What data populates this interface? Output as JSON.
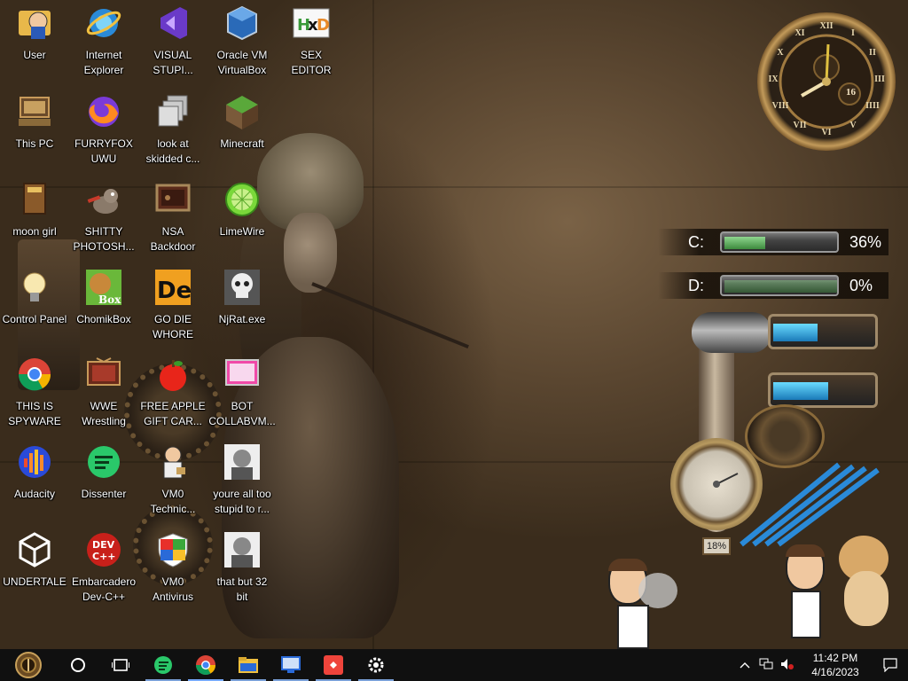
{
  "desktop": {
    "icons": [
      {
        "label": "User",
        "icon": "user-folder-icon"
      },
      {
        "label": "Internet\nExplorer",
        "icon": "internet-explorer-icon"
      },
      {
        "label": "VISUAL\nSTUPI...",
        "icon": "visual-studio-icon"
      },
      {
        "label": "Oracle VM\nVirtualBox",
        "icon": "virtualbox-icon"
      },
      {
        "label": "SEX\nEDITOR",
        "icon": "hex-editor-icon"
      },
      {
        "label": "This PC",
        "icon": "computer-icon"
      },
      {
        "label": "FURRYFOX\nUWU",
        "icon": "firefox-icon"
      },
      {
        "label": "look at\nskidded c...",
        "icon": "shortcut-stack-icon"
      },
      {
        "label": "Minecraft",
        "icon": "minecraft-icon"
      },
      {
        "label": "moon girl",
        "icon": "book-icon"
      },
      {
        "label": "SHITTY\nPHOTOSH...",
        "icon": "gimp-icon"
      },
      {
        "label": "NSA\nBackdoor",
        "icon": "monitor-icon"
      },
      {
        "label": "LimeWire",
        "icon": "limewire-icon"
      },
      {
        "label": "Control Panel",
        "icon": "lightbulb-icon"
      },
      {
        "label": "ChomikBox",
        "icon": "chomikbox-icon"
      },
      {
        "label": "GO DIE\nWHORE",
        "icon": "de-icon"
      },
      {
        "label": "NjRat.exe",
        "icon": "skull-icon"
      },
      {
        "label": "THIS IS\nSPYWARE",
        "icon": "chrome-icon"
      },
      {
        "label": "WWE\nWrestling",
        "icon": "tv-icon"
      },
      {
        "label": "FREE APPLE\nGIFT CAR...",
        "icon": "apple-icon"
      },
      {
        "label": "BOT\nCOLLABVM...",
        "icon": "screen-icon"
      },
      {
        "label": "Audacity",
        "icon": "audacity-icon"
      },
      {
        "label": "Dissenter",
        "icon": "dissenter-icon"
      },
      {
        "label": "VM0\nTechnic...",
        "icon": "technician-icon"
      },
      {
        "label": "youre all too\nstupid to r...",
        "icon": "portrait-icon"
      },
      {
        "label": "UNDERTALE",
        "icon": "unity-icon"
      },
      {
        "label": "Embarcadero\nDev-C++",
        "icon": "devcpp-icon"
      },
      {
        "label": "VM0\nAntivirus",
        "icon": "shield-icon"
      },
      {
        "label": "that but 32\nbit",
        "icon": "portrait-icon"
      }
    ]
  },
  "gadgets": {
    "clock": {
      "numerals": [
        "XII",
        "I",
        "II",
        "III",
        "IIII",
        "V",
        "VI",
        "VII",
        "VIII",
        "IX",
        "X",
        "XI"
      ],
      "date_badge": "16"
    },
    "drives": [
      {
        "letter": "C:",
        "percent": 36,
        "label": "36%"
      },
      {
        "letter": "D:",
        "percent": 0,
        "label": "0%"
      }
    ],
    "cpu_tubes": [
      {
        "fraction": 0.45
      },
      {
        "fraction": 0.55
      }
    ],
    "gauge": {
      "label": "18%"
    }
  },
  "taskbar": {
    "buttons": [
      {
        "name": "start-button",
        "icon": "steampunk-start-icon"
      },
      {
        "name": "search-button",
        "icon": "circle-search-icon"
      },
      {
        "name": "task-view-button",
        "icon": "task-view-icon"
      },
      {
        "name": "dissenter-taskbar",
        "icon": "dissenter-icon"
      },
      {
        "name": "chrome-taskbar",
        "icon": "chrome-icon",
        "active": true
      },
      {
        "name": "explorer-taskbar",
        "icon": "folder-icon"
      },
      {
        "name": "rdp-taskbar",
        "icon": "remote-desktop-icon"
      },
      {
        "name": "anydesk-taskbar",
        "icon": "anydesk-icon"
      },
      {
        "name": "settings-taskbar",
        "icon": "gear-icon"
      }
    ],
    "tray": {
      "time": "11:42 PM",
      "date": "4/16/2023"
    }
  },
  "colors": {
    "taskbar": "#101010",
    "accent": "#77aaff",
    "drive_fill": "#4caf50",
    "cpu_fill": "#3ab0e8"
  }
}
